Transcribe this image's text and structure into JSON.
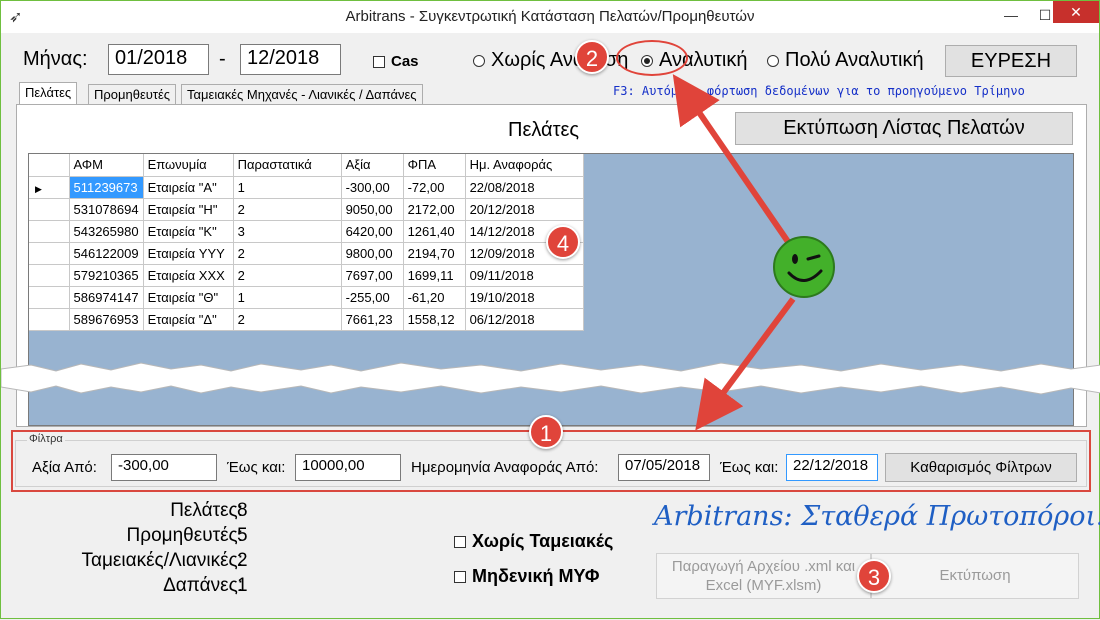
{
  "window": {
    "title": "Arbitrans - Συγκεντρωτική Κατάσταση Πελατών/Προμηθευτών",
    "minimize": "—",
    "maximize": "☐",
    "close": "✕",
    "app_icon": "bird-icon"
  },
  "period": {
    "month_label": "Μήνας:",
    "from": "01/2018",
    "dash": "-",
    "to": "12/2018",
    "cas_label": "Cas"
  },
  "mode": {
    "options": [
      "Χωρίς Ανάλυση",
      "Αναλυτική",
      "Πολύ Αναλυτική"
    ],
    "selected": "Αναλυτική",
    "search_button": "ΕΥΡΕΣΗ"
  },
  "hint": "F3: Αυτόματη φόρτωση δεδομένων για το προηγούμενο Τρίμηνο",
  "tabs": [
    "Πελάτες",
    "Προμηθευτές",
    "Ταμειακές Μηχανές - Λιανικές / Δαπάνες"
  ],
  "panel": {
    "heading": "Πελάτες",
    "print_list_button": "Εκτύπωση Λίστας Πελατών"
  },
  "grid": {
    "columns": [
      "ΑΦΜ",
      "Επωνυμία",
      "Παραστατικά",
      "Αξία",
      "ΦΠΑ",
      "Ημ. Αναφοράς"
    ],
    "rows": [
      [
        "511239673",
        "Εταιρεία \"Α\"",
        "1",
        "-300,00",
        "-72,00",
        "22/08/2018"
      ],
      [
        "531078694",
        "Εταιρεία \"Η\"",
        "2",
        "9050,00",
        "2172,00",
        "20/12/2018"
      ],
      [
        "543265980",
        "Εταιρεία \"Κ\"",
        "3",
        "6420,00",
        "1261,40",
        "14/12/2018"
      ],
      [
        "546122009",
        "Εταιρεία YYY",
        "2",
        "9800,00",
        "2194,70",
        "12/09/2018"
      ],
      [
        "579210365",
        "Εταιρεία XXX",
        "2",
        "7697,00",
        "1699,11",
        "09/11/2018"
      ],
      [
        "586974147",
        "Εταιρεία \"Θ\"",
        "1",
        "-255,00",
        "-61,20",
        "19/10/2018"
      ],
      [
        "589676953",
        "Εταιρεία \"Δ\"",
        "2",
        "7661,23",
        "1558,12",
        "06/12/2018"
      ]
    ],
    "current_row_marker": "▶"
  },
  "filters": {
    "group_label": "Φίλτρα",
    "value_from_label": "Αξία Από:",
    "value_from": "-300,00",
    "value_to_label": "Έως και:",
    "value_to": "10000,00",
    "date_from_label": "Ημερομηνία Αναφοράς Από:",
    "date_from": "07/05/2018",
    "date_to_label": "Έως και:",
    "date_to": "22/12/2018",
    "clear_button": "Καθαρισμός Φίλτρων"
  },
  "counts": [
    {
      "label": "Πελάτες:",
      "value": "8"
    },
    {
      "label": "Προμηθευτές:",
      "value": "5"
    },
    {
      "label": "Ταμειακές/Λιανικές:",
      "value": "2"
    },
    {
      "label": "Δαπάνες:",
      "value": "1"
    }
  ],
  "options": {
    "no_cash_registers": "Χωρίς Ταμειακές",
    "zero_myf": "Μηδενική ΜΥΦ"
  },
  "actions": {
    "generate_file": "Παραγωγή Αρχείου .xml και Excel (MYF.xlsm)",
    "print": "Εκτύπωση"
  },
  "slogan": "Arbitrans: Σταθερά Πρωτοπόροι!",
  "callouts": [
    "1",
    "2",
    "3",
    "4"
  ],
  "colors": {
    "accent_red": "#e0443a",
    "grid_background": "#98b3d0",
    "selection": "#3399ff",
    "slogan_blue": "#1f5fc4",
    "smiley_green": "#43b02a"
  }
}
